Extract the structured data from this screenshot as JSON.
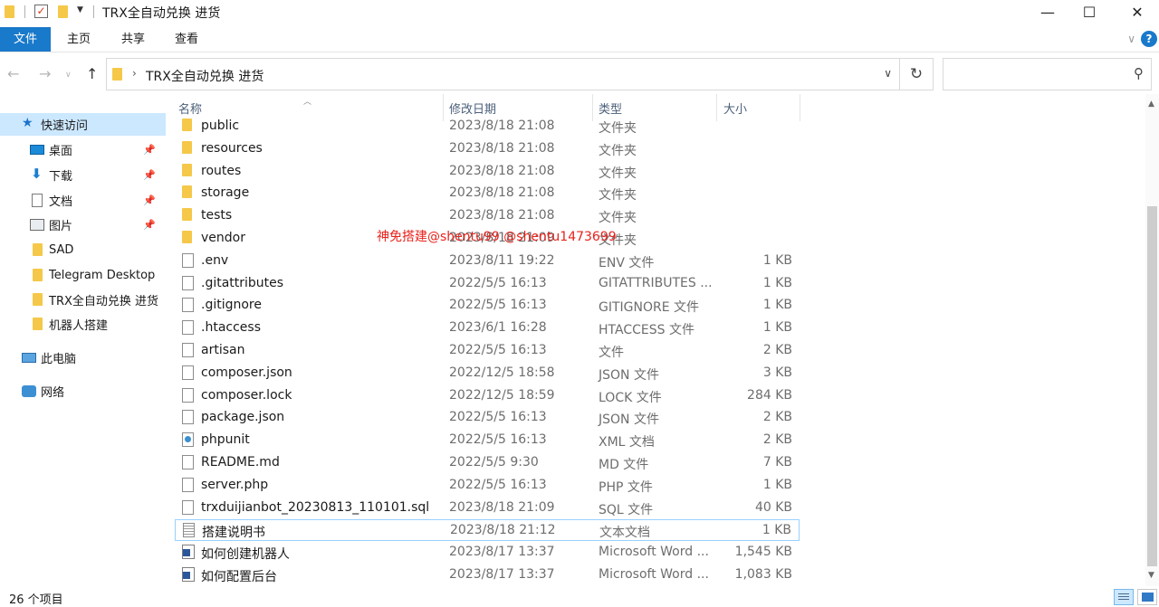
{
  "window": {
    "title": "TRX全自动兑换 进货",
    "minimize": "—",
    "maximize": "☐",
    "close": "✕"
  },
  "ribbon": {
    "tabs": [
      "文件",
      "主页",
      "共享",
      "查看"
    ],
    "help": "?"
  },
  "address": {
    "path": "TRX全自动兑换 进货",
    "separator": "›",
    "search_placeholder": ""
  },
  "nav_pane": {
    "items": [
      {
        "label": "快速访问",
        "icon": "star-icon",
        "pinned": false
      },
      {
        "label": "桌面",
        "icon": "desktop-icon",
        "pinned": true
      },
      {
        "label": "下载",
        "icon": "download-icon",
        "pinned": true
      },
      {
        "label": "文档",
        "icon": "document-icon",
        "pinned": true
      },
      {
        "label": "图片",
        "icon": "pictures-icon",
        "pinned": true
      },
      {
        "label": "SAD",
        "icon": "folder-icon",
        "pinned": false
      },
      {
        "label": "Telegram Desktop",
        "icon": "folder-icon",
        "pinned": false
      },
      {
        "label": "TRX全自动兑换 进货",
        "icon": "folder-icon",
        "pinned": false
      },
      {
        "label": "机器人搭建",
        "icon": "folder-icon",
        "pinned": false
      },
      {
        "label": "此电脑",
        "icon": "computer-icon",
        "pinned": false
      },
      {
        "label": "网络",
        "icon": "network-icon",
        "pinned": false
      }
    ]
  },
  "file_list": {
    "columns": [
      "名称",
      "修改日期",
      "类型",
      "大小"
    ],
    "rows": [
      {
        "name": "public",
        "date": "2023/8/18 21:08",
        "type": "文件夹",
        "size": "",
        "icon": "folder"
      },
      {
        "name": "resources",
        "date": "2023/8/18 21:08",
        "type": "文件夹",
        "size": "",
        "icon": "folder"
      },
      {
        "name": "routes",
        "date": "2023/8/18 21:08",
        "type": "文件夹",
        "size": "",
        "icon": "folder"
      },
      {
        "name": "storage",
        "date": "2023/8/18 21:08",
        "type": "文件夹",
        "size": "",
        "icon": "folder"
      },
      {
        "name": "tests",
        "date": "2023/8/18 21:08",
        "type": "文件夹",
        "size": "",
        "icon": "folder"
      },
      {
        "name": "vendor",
        "date": "2023/8/18 21:09",
        "type": "文件夹",
        "size": "",
        "icon": "folder"
      },
      {
        "name": ".env",
        "date": "2023/8/11 19:22",
        "type": "ENV 文件",
        "size": "1 KB",
        "icon": "file"
      },
      {
        "name": ".gitattributes",
        "date": "2022/5/5 16:13",
        "type": "GITATTRIBUTES ...",
        "size": "1 KB",
        "icon": "file"
      },
      {
        "name": ".gitignore",
        "date": "2022/5/5 16:13",
        "type": "GITIGNORE 文件",
        "size": "1 KB",
        "icon": "file"
      },
      {
        "name": ".htaccess",
        "date": "2023/6/1 16:28",
        "type": "HTACCESS 文件",
        "size": "1 KB",
        "icon": "file"
      },
      {
        "name": "artisan",
        "date": "2022/5/5 16:13",
        "type": "文件",
        "size": "2 KB",
        "icon": "file"
      },
      {
        "name": "composer.json",
        "date": "2022/12/5 18:58",
        "type": "JSON 文件",
        "size": "3 KB",
        "icon": "file"
      },
      {
        "name": "composer.lock",
        "date": "2022/12/5 18:59",
        "type": "LOCK 文件",
        "size": "284 KB",
        "icon": "file"
      },
      {
        "name": "package.json",
        "date": "2022/5/5 16:13",
        "type": "JSON 文件",
        "size": "2 KB",
        "icon": "file"
      },
      {
        "name": "phpunit",
        "date": "2022/5/5 16:13",
        "type": "XML 文档",
        "size": "2 KB",
        "icon": "xml"
      },
      {
        "name": "README.md",
        "date": "2022/5/5 9:30",
        "type": "MD 文件",
        "size": "7 KB",
        "icon": "file"
      },
      {
        "name": "server.php",
        "date": "2022/5/5 16:13",
        "type": "PHP 文件",
        "size": "1 KB",
        "icon": "file"
      },
      {
        "name": "trxduijianbot_20230813_110101.sql",
        "date": "2023/8/18 21:09",
        "type": "SQL 文件",
        "size": "40 KB",
        "icon": "file"
      },
      {
        "name": "搭建说明书",
        "date": "2023/8/18 21:12",
        "type": "文本文档",
        "size": "1 KB",
        "icon": "txt"
      },
      {
        "name": "如何创建机器人",
        "date": "2023/8/17 13:37",
        "type": "Microsoft Word ...",
        "size": "1,545 KB",
        "icon": "word"
      },
      {
        "name": "如何配置后台",
        "date": "2023/8/17 13:37",
        "type": "Microsoft Word ...",
        "size": "1,083 KB",
        "icon": "word"
      }
    ]
  },
  "watermark": "神免搭建@shentu99 @shentu1473699",
  "status": {
    "count": "26 个项目"
  },
  "colors": {
    "accent": "#1979ca",
    "selected_bg": "#cce8ff",
    "watermark": "#e8231c"
  }
}
